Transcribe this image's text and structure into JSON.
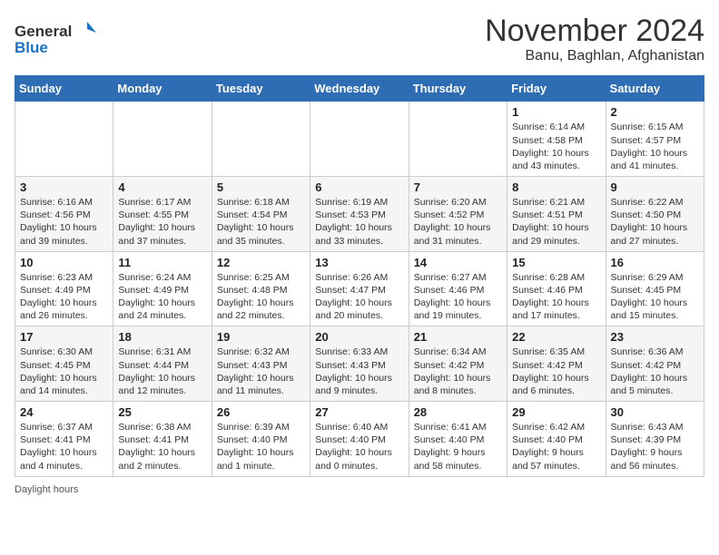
{
  "header": {
    "logo_line1": "General",
    "logo_line2": "Blue",
    "month": "November 2024",
    "location": "Banu, Baghlan, Afghanistan"
  },
  "days_of_week": [
    "Sunday",
    "Monday",
    "Tuesday",
    "Wednesday",
    "Thursday",
    "Friday",
    "Saturday"
  ],
  "weeks": [
    [
      {
        "day": "",
        "detail": ""
      },
      {
        "day": "",
        "detail": ""
      },
      {
        "day": "",
        "detail": ""
      },
      {
        "day": "",
        "detail": ""
      },
      {
        "day": "",
        "detail": ""
      },
      {
        "day": "1",
        "detail": "Sunrise: 6:14 AM\nSunset: 4:58 PM\nDaylight: 10 hours and 43 minutes."
      },
      {
        "day": "2",
        "detail": "Sunrise: 6:15 AM\nSunset: 4:57 PM\nDaylight: 10 hours and 41 minutes."
      }
    ],
    [
      {
        "day": "3",
        "detail": "Sunrise: 6:16 AM\nSunset: 4:56 PM\nDaylight: 10 hours and 39 minutes."
      },
      {
        "day": "4",
        "detail": "Sunrise: 6:17 AM\nSunset: 4:55 PM\nDaylight: 10 hours and 37 minutes."
      },
      {
        "day": "5",
        "detail": "Sunrise: 6:18 AM\nSunset: 4:54 PM\nDaylight: 10 hours and 35 minutes."
      },
      {
        "day": "6",
        "detail": "Sunrise: 6:19 AM\nSunset: 4:53 PM\nDaylight: 10 hours and 33 minutes."
      },
      {
        "day": "7",
        "detail": "Sunrise: 6:20 AM\nSunset: 4:52 PM\nDaylight: 10 hours and 31 minutes."
      },
      {
        "day": "8",
        "detail": "Sunrise: 6:21 AM\nSunset: 4:51 PM\nDaylight: 10 hours and 29 minutes."
      },
      {
        "day": "9",
        "detail": "Sunrise: 6:22 AM\nSunset: 4:50 PM\nDaylight: 10 hours and 27 minutes."
      }
    ],
    [
      {
        "day": "10",
        "detail": "Sunrise: 6:23 AM\nSunset: 4:49 PM\nDaylight: 10 hours and 26 minutes."
      },
      {
        "day": "11",
        "detail": "Sunrise: 6:24 AM\nSunset: 4:49 PM\nDaylight: 10 hours and 24 minutes."
      },
      {
        "day": "12",
        "detail": "Sunrise: 6:25 AM\nSunset: 4:48 PM\nDaylight: 10 hours and 22 minutes."
      },
      {
        "day": "13",
        "detail": "Sunrise: 6:26 AM\nSunset: 4:47 PM\nDaylight: 10 hours and 20 minutes."
      },
      {
        "day": "14",
        "detail": "Sunrise: 6:27 AM\nSunset: 4:46 PM\nDaylight: 10 hours and 19 minutes."
      },
      {
        "day": "15",
        "detail": "Sunrise: 6:28 AM\nSunset: 4:46 PM\nDaylight: 10 hours and 17 minutes."
      },
      {
        "day": "16",
        "detail": "Sunrise: 6:29 AM\nSunset: 4:45 PM\nDaylight: 10 hours and 15 minutes."
      }
    ],
    [
      {
        "day": "17",
        "detail": "Sunrise: 6:30 AM\nSunset: 4:45 PM\nDaylight: 10 hours and 14 minutes."
      },
      {
        "day": "18",
        "detail": "Sunrise: 6:31 AM\nSunset: 4:44 PM\nDaylight: 10 hours and 12 minutes."
      },
      {
        "day": "19",
        "detail": "Sunrise: 6:32 AM\nSunset: 4:43 PM\nDaylight: 10 hours and 11 minutes."
      },
      {
        "day": "20",
        "detail": "Sunrise: 6:33 AM\nSunset: 4:43 PM\nDaylight: 10 hours and 9 minutes."
      },
      {
        "day": "21",
        "detail": "Sunrise: 6:34 AM\nSunset: 4:42 PM\nDaylight: 10 hours and 8 minutes."
      },
      {
        "day": "22",
        "detail": "Sunrise: 6:35 AM\nSunset: 4:42 PM\nDaylight: 10 hours and 6 minutes."
      },
      {
        "day": "23",
        "detail": "Sunrise: 6:36 AM\nSunset: 4:42 PM\nDaylight: 10 hours and 5 minutes."
      }
    ],
    [
      {
        "day": "24",
        "detail": "Sunrise: 6:37 AM\nSunset: 4:41 PM\nDaylight: 10 hours and 4 minutes."
      },
      {
        "day": "25",
        "detail": "Sunrise: 6:38 AM\nSunset: 4:41 PM\nDaylight: 10 hours and 2 minutes."
      },
      {
        "day": "26",
        "detail": "Sunrise: 6:39 AM\nSunset: 4:40 PM\nDaylight: 10 hours and 1 minute."
      },
      {
        "day": "27",
        "detail": "Sunrise: 6:40 AM\nSunset: 4:40 PM\nDaylight: 10 hours and 0 minutes."
      },
      {
        "day": "28",
        "detail": "Sunrise: 6:41 AM\nSunset: 4:40 PM\nDaylight: 9 hours and 58 minutes."
      },
      {
        "day": "29",
        "detail": "Sunrise: 6:42 AM\nSunset: 4:40 PM\nDaylight: 9 hours and 57 minutes."
      },
      {
        "day": "30",
        "detail": "Sunrise: 6:43 AM\nSunset: 4:39 PM\nDaylight: 9 hours and 56 minutes."
      }
    ]
  ],
  "footer": {
    "note": "Daylight hours"
  }
}
